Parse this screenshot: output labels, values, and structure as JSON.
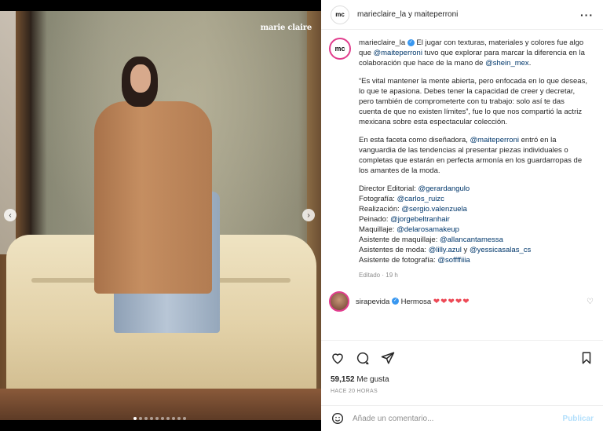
{
  "photo": {
    "brand": "marie claire",
    "slide_count": 10,
    "active_slide": 1
  },
  "header": {
    "avatar_text": "mc",
    "title": "marieclaire_la y maiteperroni",
    "more_icon": "more-horizontal-icon"
  },
  "caption": {
    "avatar_text": "mc",
    "username": "marieclaire_la",
    "p1_a": " El jugar con texturas, materiales y colores fue algo que ",
    "p1_mention1": "@maiteperroni",
    "p1_b": " tuvo que explorar para marcar la diferencia en la colaboración que hace de la mano de ",
    "p1_mention2": "@shein_mex",
    "p1_c": ".",
    "p2": "“Es vital mantener la mente abierta, pero enfocada en lo que deseas, lo que te apasiona. Debes tener la capacidad de creer y decretar, pero también de comprometerte con tu trabajo: solo así te das cuenta de que no existen límites”, fue lo que nos compartió la actriz mexicana sobre esta espectacular colección.",
    "p3_a": "En esta faceta como diseñadora, ",
    "p3_mention": "@maiteperroni",
    "p3_b": " entró en la vanguardia de las tendencias al presentar piezas individuales o completas que estarán en perfecta armonía en los guardarropas de los amantes de la moda.",
    "credits": [
      {
        "label": "Director Editorial: ",
        "handle": "@gerardangulo"
      },
      {
        "label": "Fotografía: ",
        "handle": "@carlos_ruizc"
      },
      {
        "label": "Realización: ",
        "handle": "@sergio.valenzuela"
      },
      {
        "label": "Peinado: ",
        "handle": "@jorgebeltranhair"
      },
      {
        "label": "Maquillaje: ",
        "handle": "@delarosamakeup"
      },
      {
        "label": "Asistente de maquillaje: ",
        "handle": "@allancantamessa"
      },
      {
        "label": "Asistentes de moda: ",
        "handle": "@lilly.azul",
        "label2": " y ",
        "handle2": "@yessicasalas_cs"
      },
      {
        "label": "Asistente de fotografía: ",
        "handle": "@soffffiiia"
      }
    ],
    "meta": "Editado · 19 h"
  },
  "comment": {
    "username": "sirapevida",
    "text": " Hermosa ",
    "hearts": "❤❤❤❤❤"
  },
  "actions": {
    "likes_count": "59,152",
    "likes_label": " Me gusta",
    "ago": "HACE 20 HORAS"
  },
  "add_comment": {
    "placeholder": "Añade un comentario...",
    "publish": "Publicar"
  },
  "colors": {
    "link": "#00376b",
    "verified": "#3897f0",
    "heart": "#ed4956",
    "publish_disabled": "#b2dffc"
  }
}
